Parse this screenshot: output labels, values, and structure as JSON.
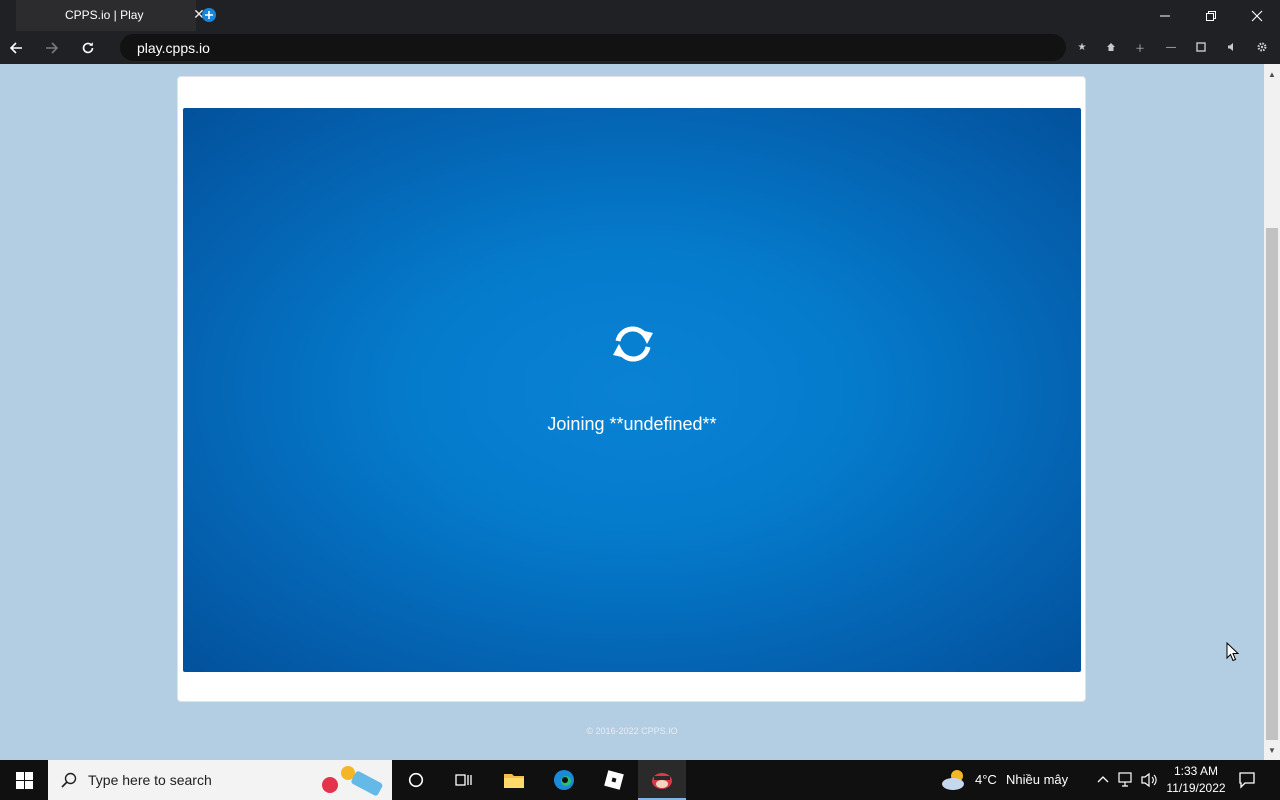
{
  "browser": {
    "tab_title": "CPPS.io | Play",
    "url": "play.cpps.io"
  },
  "page": {
    "status_text": "Joining **undefined**",
    "copyright": "© 2016-2022 CPPS.IO"
  },
  "taskbar": {
    "search_placeholder": "Type here to search",
    "weather_temp": "4°C",
    "weather_desc": "Nhiều mây",
    "time": "1:33 AM",
    "date": "11/19/2022"
  },
  "colors": {
    "page_background": "#b3cde3",
    "game_blue": "#0579cb",
    "browser_chrome": "#202124"
  }
}
